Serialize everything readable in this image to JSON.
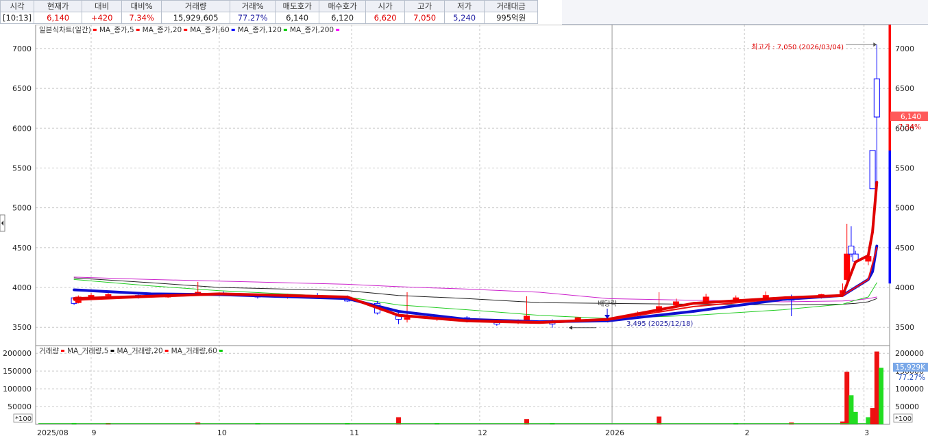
{
  "quote": {
    "headers": {
      "time": "시각",
      "price": "현재가",
      "change": "대비",
      "change_pct": "대비%",
      "volume": "거래량",
      "volume_pct": "거래%",
      "ask": "매도호가",
      "bid": "매수호가",
      "open": "시가",
      "high": "고가",
      "low": "저가",
      "amount": "거래대금"
    },
    "values": {
      "time": "[10:13]",
      "price": "6,140",
      "change": "+420",
      "change_pct": "7.34%",
      "volume": "15,929,605",
      "volume_pct": "77.27%",
      "ask": "6,140",
      "bid": "6,120",
      "open": "6,620",
      "high": "7,050",
      "low": "5,240",
      "amount": "995억원"
    }
  },
  "colors": {
    "up": "#ff0000",
    "down": "#0000ff",
    "ma5": "#e00000",
    "ma20": "#ee1111",
    "ma60": "#1010d0",
    "ma120": "#22cc22",
    "ma200": "#222222",
    "ma_extra": "#cc22cc",
    "vol_up": "#ee1111",
    "vol_down": "#22dd22"
  },
  "chart_data": {
    "type": "candlestick",
    "price_legend": [
      {
        "text": "일본식차트(일간)",
        "color": "#ff0000"
      },
      {
        "text": "MA_종가,5",
        "color": "#ff0000"
      },
      {
        "text": "MA_종가,20",
        "color": "#ff0000"
      },
      {
        "text": "MA_종가,60",
        "color": "#0000ff"
      },
      {
        "text": "MA_종가,120",
        "color": "#00cc00"
      },
      {
        "text": "MA_종가,200",
        "color": "#ff00ff"
      }
    ],
    "volume_legend": [
      {
        "text": "거래량",
        "color": "#ff0000"
      },
      {
        "text": "MA_거래량,5",
        "color": "#000000"
      },
      {
        "text": "MA_거래량,20",
        "color": "#ff0000"
      },
      {
        "text": "MA_거래량,60",
        "color": "#00cc00"
      }
    ],
    "price_ticks": [
      3500,
      4000,
      4500,
      5000,
      5500,
      6000,
      6500,
      7000
    ],
    "ylim": [
      3270,
      7300
    ],
    "volume_ticks": [
      50000,
      100000,
      150000,
      200000
    ],
    "volume_ylim": [
      0,
      210000
    ],
    "volume_unit": "*100",
    "x_labels": [
      "2025/08",
      "9",
      "10",
      "11",
      "12",
      "2026",
      "2",
      "3"
    ],
    "high_annotation": "최고가 : 7,050 (2026/03/04)",
    "low_annotation": "3,495 (2025/12/18)",
    "dividend_label": "배당락",
    "current_price_label": "6,140",
    "current_pct_label": "7.34%",
    "current_volume_label": "15,929K",
    "current_volume_pct_label": "77.27%",
    "candles": [
      {
        "d": "2025-08-28",
        "o": 3870,
        "h": 3880,
        "l": 3780,
        "c": 3800
      },
      {
        "d": "2025-08-29",
        "o": 3810,
        "h": 3900,
        "l": 3800,
        "c": 3880
      },
      {
        "d": "2025-09-01",
        "o": 3880,
        "h": 3930,
        "l": 3860,
        "c": 3900
      },
      {
        "d": "2025-09-05",
        "o": 3900,
        "h": 3930,
        "l": 3880,
        "c": 3910
      },
      {
        "d": "2025-09-12",
        "o": 3900,
        "h": 3910,
        "l": 3860,
        "c": 3880
      },
      {
        "d": "2025-09-19",
        "o": 3880,
        "h": 3930,
        "l": 3870,
        "c": 3920
      },
      {
        "d": "2025-09-26",
        "o": 3920,
        "h": 4070,
        "l": 3900,
        "c": 3940
      },
      {
        "d": "2025-10-02",
        "o": 3930,
        "h": 3950,
        "l": 3900,
        "c": 3920
      },
      {
        "d": "2025-10-10",
        "o": 3900,
        "h": 3920,
        "l": 3860,
        "c": 3880
      },
      {
        "d": "2025-10-17",
        "o": 3880,
        "h": 3920,
        "l": 3860,
        "c": 3910
      },
      {
        "d": "2025-10-24",
        "o": 3900,
        "h": 3930,
        "l": 3870,
        "c": 3880
      },
      {
        "d": "2025-10-31",
        "o": 3880,
        "h": 3900,
        "l": 3820,
        "c": 3830
      },
      {
        "d": "2025-11-07",
        "o": 3800,
        "h": 3830,
        "l": 3660,
        "c": 3680
      },
      {
        "d": "2025-11-12",
        "o": 3640,
        "h": 3680,
        "l": 3540,
        "c": 3600
      },
      {
        "d": "2025-11-14",
        "o": 3600,
        "h": 3940,
        "l": 3560,
        "c": 3620
      },
      {
        "d": "2025-11-21",
        "o": 3620,
        "h": 3660,
        "l": 3580,
        "c": 3640
      },
      {
        "d": "2025-11-28",
        "o": 3620,
        "h": 3640,
        "l": 3560,
        "c": 3580
      },
      {
        "d": "2025-12-05",
        "o": 3560,
        "h": 3590,
        "l": 3520,
        "c": 3540
      },
      {
        "d": "2025-12-10",
        "o": 3560,
        "h": 3600,
        "l": 3540,
        "c": 3590
      },
      {
        "d": "2025-12-12",
        "o": 3580,
        "h": 3890,
        "l": 3560,
        "c": 3640
      },
      {
        "d": "2025-12-18",
        "o": 3560,
        "h": 3600,
        "l": 3495,
        "c": 3540
      },
      {
        "d": "2025-12-24",
        "o": 3580,
        "h": 3630,
        "l": 3560,
        "c": 3620
      },
      {
        "d": "2025-12-31",
        "o": 3580,
        "h": 3620,
        "l": 3560,
        "c": 3600
      },
      {
        "d": "2026-01-07",
        "o": 3650,
        "h": 3700,
        "l": 3620,
        "c": 3680
      },
      {
        "d": "2026-01-12",
        "o": 3700,
        "h": 3940,
        "l": 3680,
        "c": 3760
      },
      {
        "d": "2026-01-16",
        "o": 3780,
        "h": 3860,
        "l": 3760,
        "c": 3820
      },
      {
        "d": "2026-01-23",
        "o": 3820,
        "h": 3920,
        "l": 3800,
        "c": 3880
      },
      {
        "d": "2026-01-30",
        "o": 3850,
        "h": 3900,
        "l": 3830,
        "c": 3870
      },
      {
        "d": "2026-02-06",
        "o": 3870,
        "h": 3950,
        "l": 3850,
        "c": 3900
      },
      {
        "d": "2026-02-12",
        "o": 3880,
        "h": 3910,
        "l": 3640,
        "c": 3840
      },
      {
        "d": "2026-02-19",
        "o": 3880,
        "h": 3920,
        "l": 3860,
        "c": 3910
      },
      {
        "d": "2026-02-24",
        "o": 3920,
        "h": 4050,
        "l": 3900,
        "c": 3960
      },
      {
        "d": "2026-02-25",
        "o": 4100,
        "h": 4800,
        "l": 4050,
        "c": 4420
      },
      {
        "d": "2026-02-26",
        "o": 4520,
        "h": 4770,
        "l": 4380,
        "c": 4420
      },
      {
        "d": "2026-02-27",
        "o": 4420,
        "h": 4460,
        "l": 4300,
        "c": 4330
      },
      {
        "d": "2026-03-02",
        "o": 4330,
        "h": 4440,
        "l": 4280,
        "c": 4390
      },
      {
        "d": "2026-03-03",
        "o": 5720,
        "h": 5720,
        "l": 5240,
        "c": 5240
      },
      {
        "d": "2026-03-04",
        "o": 6620,
        "h": 7050,
        "l": 5240,
        "c": 6140
      }
    ],
    "ma5": [
      [
        "2025-08-28",
        3860
      ],
      [
        "2025-09-15",
        3890
      ],
      [
        "2025-10-01",
        3920
      ],
      [
        "2025-10-31",
        3880
      ],
      [
        "2025-11-12",
        3650
      ],
      [
        "2025-11-28",
        3580
      ],
      [
        "2025-12-15",
        3560
      ],
      [
        "2025-12-31",
        3600
      ],
      [
        "2026-01-20",
        3800
      ],
      [
        "2026-02-10",
        3870
      ],
      [
        "2026-02-24",
        3900
      ],
      [
        "2026-02-27",
        4320
      ],
      [
        "2026-03-02",
        4400
      ],
      [
        "2026-03-03",
        4700
      ],
      [
        "2026-03-04",
        5320
      ]
    ],
    "ma20": [
      [
        "2025-08-28",
        3840
      ],
      [
        "2025-09-15",
        3880
      ],
      [
        "2025-10-01",
        3910
      ],
      [
        "2025-10-31",
        3880
      ],
      [
        "2025-11-12",
        3660
      ],
      [
        "2025-11-28",
        3590
      ],
      [
        "2025-12-15",
        3570
      ],
      [
        "2025-12-31",
        3590
      ],
      [
        "2026-01-20",
        3760
      ],
      [
        "2026-02-10",
        3860
      ],
      [
        "2026-02-24",
        3900
      ],
      [
        "2026-02-27",
        4000
      ],
      [
        "2026-03-02",
        4100
      ],
      [
        "2026-03-03",
        4300
      ],
      [
        "2026-03-04",
        4500
      ]
    ],
    "ma60": [
      [
        "2025-08-28",
        3970
      ],
      [
        "2025-09-15",
        3920
      ],
      [
        "2025-10-01",
        3910
      ],
      [
        "2025-10-31",
        3860
      ],
      [
        "2025-11-12",
        3700
      ],
      [
        "2025-11-28",
        3600
      ],
      [
        "2025-12-15",
        3570
      ],
      [
        "2025-12-31",
        3580
      ],
      [
        "2026-01-20",
        3700
      ],
      [
        "2026-02-10",
        3850
      ],
      [
        "2026-02-24",
        3900
      ],
      [
        "2026-02-27",
        4000
      ],
      [
        "2026-03-02",
        4100
      ],
      [
        "2026-03-03",
        4200
      ],
      [
        "2026-03-04",
        4520
      ]
    ],
    "ma120": [
      [
        "2025-08-28",
        4100
      ],
      [
        "2025-09-15",
        4020
      ],
      [
        "2025-10-01",
        3960
      ],
      [
        "2025-10-31",
        3880
      ],
      [
        "2025-11-12",
        3780
      ],
      [
        "2025-11-28",
        3720
      ],
      [
        "2025-12-15",
        3650
      ],
      [
        "2025-12-31",
        3610
      ],
      [
        "2026-01-20",
        3650
      ],
      [
        "2026-02-10",
        3720
      ],
      [
        "2026-02-24",
        3790
      ],
      [
        "2026-02-27",
        3840
      ],
      [
        "2026-03-02",
        3880
      ],
      [
        "2026-03-04",
        4060
      ]
    ],
    "ma200": [
      [
        "2025-08-28",
        4120
      ],
      [
        "2025-09-15",
        4060
      ],
      [
        "2025-10-01",
        4000
      ],
      [
        "2025-10-31",
        3960
      ],
      [
        "2025-11-12",
        3900
      ],
      [
        "2025-11-28",
        3860
      ],
      [
        "2025-12-15",
        3810
      ],
      [
        "2025-12-31",
        3800
      ],
      [
        "2026-01-20",
        3790
      ],
      [
        "2026-02-10",
        3780
      ],
      [
        "2026-02-24",
        3790
      ],
      [
        "2026-02-27",
        3800
      ],
      [
        "2026-03-02",
        3820
      ],
      [
        "2026-03-04",
        3860
      ]
    ],
    "ma_extra": [
      [
        "2025-08-28",
        4130
      ],
      [
        "2025-09-15",
        4100
      ],
      [
        "2025-10-01",
        4080
      ],
      [
        "2025-10-31",
        4040
      ],
      [
        "2025-11-12",
        4010
      ],
      [
        "2025-11-28",
        3980
      ],
      [
        "2025-12-15",
        3940
      ],
      [
        "2025-12-31",
        3860
      ],
      [
        "2026-01-20",
        3840
      ],
      [
        "2026-02-10",
        3820
      ],
      [
        "2026-02-24",
        3830
      ],
      [
        "2026-02-27",
        3840
      ],
      [
        "2026-03-02",
        3860
      ],
      [
        "2026-03-04",
        3880
      ]
    ],
    "volumes": [
      {
        "d": "2025-08-28",
        "v": 4000,
        "up": false
      },
      {
        "d": "2025-09-05",
        "v": 3500,
        "up": true
      },
      {
        "d": "2025-09-26",
        "v": 5000,
        "up": true
      },
      {
        "d": "2025-10-10",
        "v": 3000,
        "up": false
      },
      {
        "d": "2025-10-31",
        "v": 3500,
        "up": false
      },
      {
        "d": "2025-11-12",
        "v": 20000,
        "up": true
      },
      {
        "d": "2025-11-21",
        "v": 3000,
        "up": false
      },
      {
        "d": "2025-12-12",
        "v": 15000,
        "up": true
      },
      {
        "d": "2025-12-18",
        "v": 3500,
        "up": false
      },
      {
        "d": "2026-01-12",
        "v": 22000,
        "up": true
      },
      {
        "d": "2026-01-30",
        "v": 4000,
        "up": false
      },
      {
        "d": "2026-02-12",
        "v": 5000,
        "up": true
      },
      {
        "d": "2026-02-24",
        "v": 8000,
        "up": true
      },
      {
        "d": "2026-02-25",
        "v": 148000,
        "up": true
      },
      {
        "d": "2026-02-26",
        "v": 82000,
        "up": false
      },
      {
        "d": "2026-02-27",
        "v": 35000,
        "up": false
      },
      {
        "d": "2026-03-02",
        "v": 20000,
        "up": false
      },
      {
        "d": "2026-03-03",
        "v": 46000,
        "up": true
      },
      {
        "d": "2026-03-04",
        "v": 205000,
        "up": true
      },
      {
        "d": "2026-03-05",
        "v": 159000,
        "up": false
      }
    ]
  }
}
